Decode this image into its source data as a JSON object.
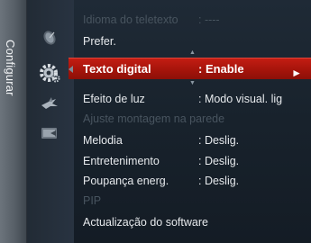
{
  "side_tab": {
    "label": "Configurar"
  },
  "icons": [
    "satellite-dish-icon",
    "gear-settings-icon",
    "bird-antenna-icon",
    "input-source-icon"
  ],
  "colors": {
    "selection": "#b8170d",
    "disabled_text": "#48545f",
    "text": "#e6e9ec"
  },
  "menu": {
    "teletext_lang": {
      "label": "Idioma do teletexto",
      "value": ": ----"
    },
    "prefer": {
      "label": "Prefer."
    },
    "digital_text": {
      "label": "Texto digital",
      "value": ": Enable",
      "arrow": "►"
    },
    "light_effect": {
      "label": "Efeito de luz",
      "value": ": Modo visual. lig"
    },
    "wall_mount": {
      "label": "Ajuste montagem na parede"
    },
    "melody": {
      "label": "Melodia",
      "value": ": Deslig."
    },
    "entertainment": {
      "label": "Entretenimento",
      "value": ": Deslig."
    },
    "energy_saving": {
      "label": "Poupança energ.",
      "value": ": Deslig."
    },
    "pip": {
      "label": "PIP"
    },
    "software_update": {
      "label": "Actualização do software"
    }
  }
}
